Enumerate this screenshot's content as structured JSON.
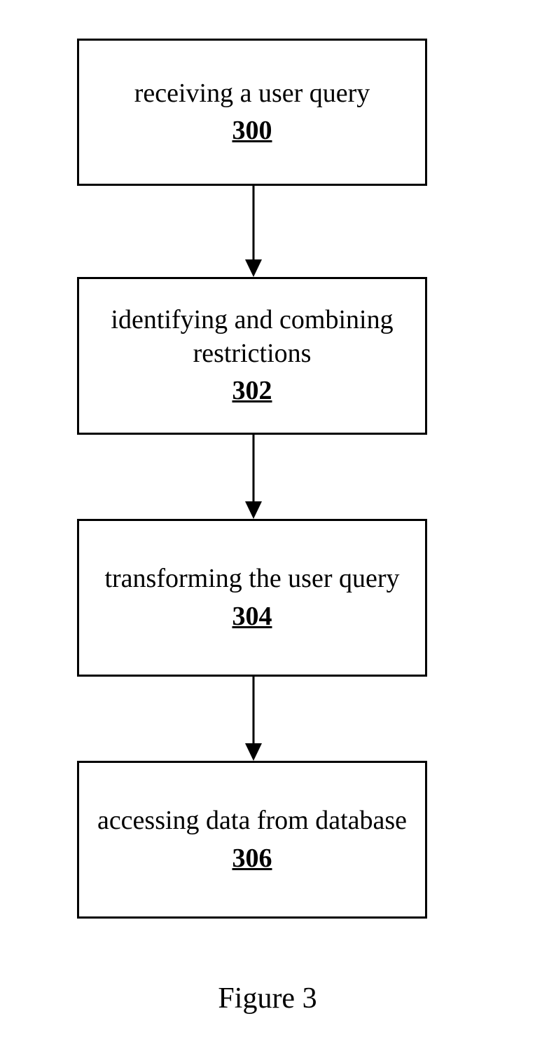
{
  "boxes": [
    {
      "label": "receiving a user query",
      "ref": "300"
    },
    {
      "label": "identifying and combining restrictions",
      "ref": "302"
    },
    {
      "label": "transforming the user query",
      "ref": "304"
    },
    {
      "label": "accessing data from database",
      "ref": "306"
    }
  ],
  "caption": "Figure 3"
}
